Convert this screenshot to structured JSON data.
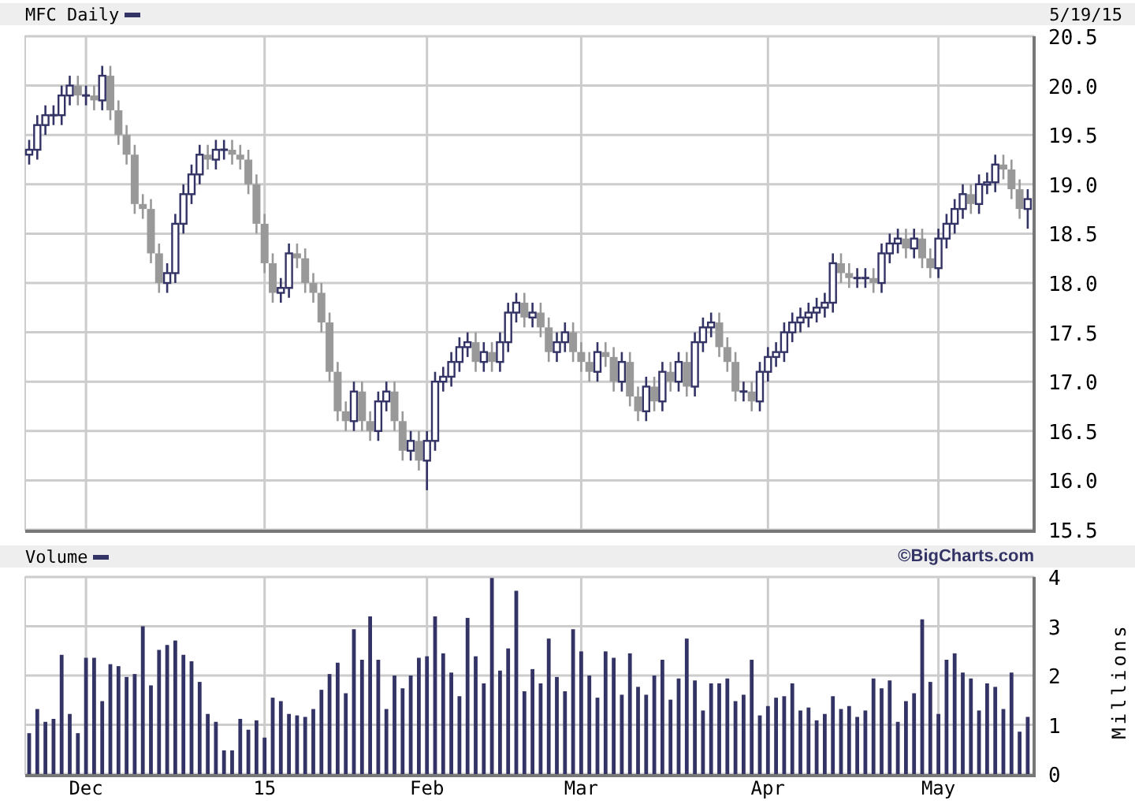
{
  "chart_header": {
    "title": "MFC Daily",
    "date": "5/19/15"
  },
  "price_chart": {
    "chart_data": {
      "type": "candlestick",
      "grid": true,
      "ylim": [
        15.5,
        20.5
      ],
      "yticks": [
        {
          "value": 20.5,
          "label": "20.5"
        },
        {
          "value": 20,
          "label": "20.0"
        },
        {
          "value": 19.5,
          "label": "19.5"
        },
        {
          "value": 19,
          "label": "19.0"
        },
        {
          "value": 18.5,
          "label": "18.5"
        },
        {
          "value": 18,
          "label": "18.0"
        },
        {
          "value": 17.5,
          "label": "17.5"
        },
        {
          "value": 17,
          "label": "17.0"
        },
        {
          "value": 16.5,
          "label": "16.5"
        },
        {
          "value": 16,
          "label": "16.0"
        },
        {
          "value": 15.5,
          "label": "15.5"
        }
      ],
      "ohlc": [
        [
          19.3,
          19.45,
          19.2,
          19.35
        ],
        [
          19.35,
          19.7,
          19.25,
          19.6
        ],
        [
          19.6,
          19.8,
          19.5,
          19.7
        ],
        [
          19.7,
          19.8,
          19.6,
          19.7
        ],
        [
          19.7,
          20.0,
          19.6,
          19.9
        ],
        [
          19.9,
          20.1,
          19.8,
          20.0
        ],
        [
          20.0,
          20.1,
          19.8,
          19.9
        ],
        [
          19.9,
          20.0,
          19.8,
          19.9
        ],
        [
          19.9,
          20.0,
          19.75,
          19.85
        ],
        [
          19.85,
          20.2,
          19.75,
          20.1
        ],
        [
          20.1,
          20.2,
          19.65,
          19.75
        ],
        [
          19.75,
          19.85,
          19.4,
          19.5
        ],
        [
          19.5,
          19.6,
          19.2,
          19.3
        ],
        [
          19.3,
          19.4,
          18.7,
          18.8
        ],
        [
          18.8,
          18.9,
          18.65,
          18.75
        ],
        [
          18.75,
          18.85,
          18.2,
          18.3
        ],
        [
          18.3,
          18.4,
          17.9,
          18.0
        ],
        [
          18.0,
          18.2,
          17.9,
          18.1
        ],
        [
          18.1,
          18.7,
          18.0,
          18.6
        ],
        [
          18.6,
          19.0,
          18.5,
          18.9
        ],
        [
          18.9,
          19.2,
          18.8,
          19.1
        ],
        [
          19.1,
          19.4,
          19.0,
          19.3
        ],
        [
          19.3,
          19.4,
          19.15,
          19.25
        ],
        [
          19.25,
          19.45,
          19.15,
          19.35
        ],
        [
          19.35,
          19.45,
          19.25,
          19.35
        ],
        [
          19.35,
          19.45,
          19.2,
          19.3
        ],
        [
          19.3,
          19.4,
          19.15,
          19.25
        ],
        [
          19.25,
          19.35,
          18.9,
          19.0
        ],
        [
          19.0,
          19.1,
          18.5,
          18.6
        ],
        [
          18.6,
          18.7,
          18.1,
          18.2
        ],
        [
          18.2,
          18.3,
          17.8,
          17.9
        ],
        [
          17.9,
          18.05,
          17.8,
          17.95
        ],
        [
          17.95,
          18.4,
          17.85,
          18.3
        ],
        [
          18.3,
          18.4,
          18.15,
          18.25
        ],
        [
          18.25,
          18.35,
          17.9,
          18.0
        ],
        [
          18.0,
          18.1,
          17.8,
          17.9
        ],
        [
          17.9,
          18.0,
          17.5,
          17.6
        ],
        [
          17.6,
          17.7,
          17.0,
          17.1
        ],
        [
          17.1,
          17.2,
          16.6,
          16.7
        ],
        [
          16.7,
          16.8,
          16.5,
          16.6
        ],
        [
          16.6,
          17.0,
          16.5,
          16.9
        ],
        [
          16.9,
          17.0,
          16.5,
          16.6
        ],
        [
          16.6,
          16.7,
          16.4,
          16.5
        ],
        [
          16.5,
          16.9,
          16.4,
          16.8
        ],
        [
          16.8,
          17.0,
          16.7,
          16.9
        ],
        [
          16.9,
          17.0,
          16.5,
          16.6
        ],
        [
          16.6,
          16.7,
          16.2,
          16.3
        ],
        [
          16.3,
          16.5,
          16.2,
          16.4
        ],
        [
          16.4,
          16.5,
          16.1,
          16.2
        ],
        [
          16.2,
          16.5,
          15.9,
          16.4
        ],
        [
          16.4,
          17.1,
          16.3,
          17.0
        ],
        [
          17.0,
          17.15,
          16.9,
          17.05
        ],
        [
          17.05,
          17.3,
          16.95,
          17.2
        ],
        [
          17.2,
          17.45,
          17.1,
          17.35
        ],
        [
          17.35,
          17.5,
          17.25,
          17.4
        ],
        [
          17.4,
          17.5,
          17.1,
          17.2
        ],
        [
          17.2,
          17.4,
          17.1,
          17.3
        ],
        [
          17.3,
          17.4,
          17.1,
          17.2
        ],
        [
          17.2,
          17.5,
          17.1,
          17.4
        ],
        [
          17.4,
          17.8,
          17.3,
          17.7
        ],
        [
          17.7,
          17.9,
          17.6,
          17.8
        ],
        [
          17.8,
          17.9,
          17.55,
          17.65
        ],
        [
          17.65,
          17.8,
          17.55,
          17.7
        ],
        [
          17.7,
          17.8,
          17.45,
          17.55
        ],
        [
          17.55,
          17.65,
          17.2,
          17.3
        ],
        [
          17.3,
          17.5,
          17.2,
          17.4
        ],
        [
          17.4,
          17.6,
          17.3,
          17.5
        ],
        [
          17.5,
          17.6,
          17.2,
          17.3
        ],
        [
          17.3,
          17.4,
          17.1,
          17.2
        ],
        [
          17.2,
          17.3,
          17.0,
          17.1
        ],
        [
          17.1,
          17.4,
          17.0,
          17.3
        ],
        [
          17.3,
          17.4,
          17.15,
          17.25
        ],
        [
          17.25,
          17.35,
          16.9,
          17.0
        ],
        [
          17.0,
          17.3,
          16.9,
          17.2
        ],
        [
          17.2,
          17.3,
          16.75,
          16.85
        ],
        [
          16.85,
          16.95,
          16.6,
          16.7
        ],
        [
          16.7,
          17.05,
          16.6,
          16.95
        ],
        [
          16.95,
          17.05,
          16.7,
          16.8
        ],
        [
          16.8,
          17.2,
          16.7,
          17.1
        ],
        [
          17.1,
          17.2,
          16.9,
          17.0
        ],
        [
          17.0,
          17.3,
          16.9,
          17.2
        ],
        [
          17.2,
          17.3,
          16.85,
          16.95
        ],
        [
          16.95,
          17.5,
          16.85,
          17.4
        ],
        [
          17.4,
          17.65,
          17.3,
          17.55
        ],
        [
          17.55,
          17.7,
          17.45,
          17.6
        ],
        [
          17.6,
          17.7,
          17.25,
          17.35
        ],
        [
          17.35,
          17.45,
          17.1,
          17.2
        ],
        [
          17.2,
          17.3,
          16.8,
          16.9
        ],
        [
          16.9,
          17.0,
          16.8,
          16.9
        ],
        [
          16.9,
          17.0,
          16.7,
          16.8
        ],
        [
          16.8,
          17.2,
          16.7,
          17.1
        ],
        [
          17.1,
          17.35,
          17.0,
          17.25
        ],
        [
          17.25,
          17.4,
          17.15,
          17.3
        ],
        [
          17.3,
          17.6,
          17.2,
          17.5
        ],
        [
          17.5,
          17.7,
          17.4,
          17.6
        ],
        [
          17.6,
          17.75,
          17.5,
          17.65
        ],
        [
          17.65,
          17.8,
          17.55,
          17.7
        ],
        [
          17.7,
          17.85,
          17.6,
          17.75
        ],
        [
          17.75,
          17.9,
          17.65,
          17.8
        ],
        [
          17.8,
          18.3,
          17.7,
          18.2
        ],
        [
          18.2,
          18.3,
          18.0,
          18.1
        ],
        [
          18.1,
          18.2,
          17.95,
          18.05
        ],
        [
          18.05,
          18.15,
          17.95,
          18.05
        ],
        [
          18.05,
          18.15,
          17.95,
          18.05
        ],
        [
          18.05,
          18.15,
          17.9,
          18.0
        ],
        [
          18.0,
          18.4,
          17.9,
          18.3
        ],
        [
          18.3,
          18.5,
          18.2,
          18.4
        ],
        [
          18.4,
          18.55,
          18.3,
          18.45
        ],
        [
          18.45,
          18.55,
          18.25,
          18.35
        ],
        [
          18.35,
          18.55,
          18.25,
          18.45
        ],
        [
          18.45,
          18.55,
          18.15,
          18.25
        ],
        [
          18.25,
          18.35,
          18.05,
          18.15
        ],
        [
          18.15,
          18.55,
          18.05,
          18.45
        ],
        [
          18.45,
          18.7,
          18.35,
          18.6
        ],
        [
          18.6,
          18.85,
          18.5,
          18.75
        ],
        [
          18.75,
          19.0,
          18.65,
          18.9
        ],
        [
          18.9,
          19.0,
          18.7,
          18.8
        ],
        [
          18.8,
          19.1,
          18.7,
          19.0
        ],
        [
          19.0,
          19.12,
          18.9,
          19.02
        ],
        [
          19.02,
          19.3,
          18.92,
          19.2
        ],
        [
          19.2,
          19.3,
          19.05,
          19.15
        ],
        [
          19.15,
          19.25,
          18.85,
          18.95
        ],
        [
          18.95,
          19.05,
          18.65,
          18.75
        ],
        [
          18.75,
          18.95,
          18.55,
          18.85
        ]
      ]
    }
  },
  "volume_header": {
    "title": "Volume",
    "credit": "©BigCharts.com"
  },
  "volume_chart": {
    "chart_data": {
      "type": "bar",
      "grid": true,
      "ylabel": "Millions",
      "ylim": [
        0,
        4
      ],
      "yticks": [
        0,
        1,
        2,
        3,
        4
      ],
      "categories": [
        null,
        null,
        null,
        null,
        null,
        null,
        null,
        "Dec",
        null,
        null,
        null,
        null,
        null,
        null,
        null,
        null,
        null,
        null,
        null,
        null,
        null,
        null,
        null,
        null,
        null,
        null,
        null,
        null,
        null,
        "15",
        null,
        null,
        null,
        null,
        null,
        null,
        null,
        null,
        null,
        null,
        null,
        null,
        null,
        null,
        null,
        null,
        null,
        null,
        null,
        "Feb",
        null,
        null,
        null,
        null,
        null,
        null,
        null,
        null,
        null,
        null,
        null,
        null,
        null,
        null,
        null,
        null,
        null,
        null,
        "Mar",
        null,
        null,
        null,
        null,
        null,
        null,
        null,
        null,
        null,
        null,
        null,
        null,
        null,
        null,
        null,
        null,
        null,
        null,
        null,
        null,
        null,
        null,
        "Apr",
        null,
        null,
        null,
        null,
        null,
        null,
        null,
        null,
        null,
        null,
        null,
        null,
        null,
        null,
        null,
        null,
        null,
        null,
        null,
        null,
        "May",
        null,
        null,
        null,
        null,
        null,
        null,
        null,
        null,
        null,
        null,
        null
      ],
      "values": [
        0.83,
        1.32,
        1.06,
        1.12,
        2.42,
        1.22,
        0.83,
        2.36,
        2.36,
        1.48,
        2.23,
        2.19,
        1.97,
        2.03,
        3.0,
        1.8,
        2.52,
        2.62,
        2.71,
        2.42,
        2.29,
        1.87,
        1.22,
        1.06,
        0.48,
        0.48,
        1.12,
        0.9,
        1.09,
        0.74,
        1.55,
        1.48,
        1.22,
        1.19,
        1.16,
        1.32,
        1.71,
        2.03,
        2.26,
        1.64,
        2.94,
        2.32,
        3.2,
        2.32,
        1.32,
        2.0,
        1.74,
        2.0,
        2.36,
        2.39,
        3.2,
        2.45,
        2.06,
        1.58,
        3.17,
        2.39,
        1.84,
        3.98,
        2.1,
        2.55,
        3.72,
        1.68,
        2.13,
        1.84,
        2.75,
        1.97,
        1.68,
        2.94,
        2.49,
        2.0,
        1.55,
        2.49,
        2.36,
        1.61,
        2.45,
        1.77,
        1.61,
        2.0,
        2.32,
        1.51,
        1.94,
        2.75,
        1.9,
        1.29,
        1.84,
        1.84,
        1.94,
        1.48,
        1.61,
        2.32,
        1.19,
        1.38,
        1.55,
        1.58,
        1.84,
        1.29,
        1.35,
        1.09,
        1.22,
        1.58,
        1.32,
        1.38,
        1.16,
        1.29,
        1.94,
        1.74,
        1.9,
        1.06,
        1.48,
        1.64,
        3.14,
        1.87,
        1.22,
        2.32,
        2.45,
        2.06,
        1.94,
        1.29,
        1.84,
        1.77,
        1.32,
        2.06,
        0.86,
        1.16
      ]
    }
  }
}
